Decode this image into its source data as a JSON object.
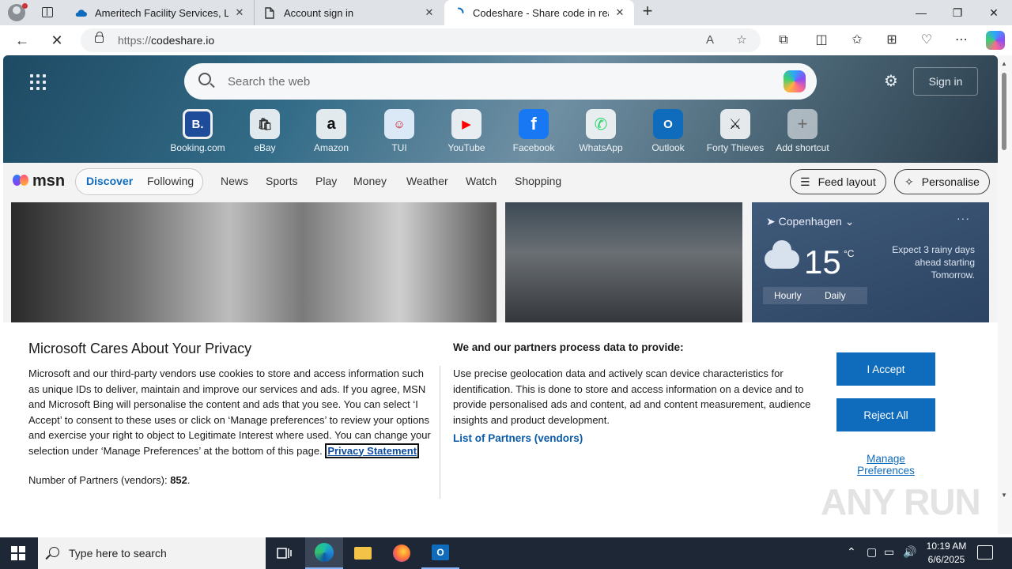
{
  "browser": {
    "tabs": [
      {
        "title": "Ameritech Facility Services, LLC -",
        "active": false
      },
      {
        "title": "Account sign in",
        "active": false
      },
      {
        "title": "Codeshare - Share code in real-ti",
        "active": true
      }
    ],
    "url_protocol": "https://",
    "url_host": "codeshare.io"
  },
  "msn": {
    "search_placeholder": "Search the web",
    "sign_in": "Sign in",
    "shortcuts": [
      {
        "label": "Booking.com",
        "glyph": "B."
      },
      {
        "label": "eBay",
        "glyph": "🛍"
      },
      {
        "label": "Amazon",
        "glyph": "a"
      },
      {
        "label": "TUI",
        "glyph": "☺"
      },
      {
        "label": "YouTube",
        "glyph": "▶"
      },
      {
        "label": "Facebook",
        "glyph": "f"
      },
      {
        "label": "WhatsApp",
        "glyph": "✆"
      },
      {
        "label": "Outlook",
        "glyph": "O"
      },
      {
        "label": "Forty Thieves",
        "glyph": "⚔"
      },
      {
        "label": "Add shortcut",
        "glyph": "+"
      }
    ],
    "logo": "msn",
    "pills": {
      "discover": "Discover",
      "following": "Following"
    },
    "nav": [
      "News",
      "Sports",
      "Play",
      "Money",
      "Weather",
      "Watch",
      "Shopping"
    ],
    "feed_layout": "Feed layout",
    "personalise": "Personalise",
    "weather": {
      "location": "Copenhagen",
      "temp": "15",
      "unit": "°C",
      "forecast": "Expect 3 rainy days ahead starting Tomorrow.",
      "tab_hourly": "Hourly",
      "tab_daily": "Daily"
    }
  },
  "consent": {
    "title": "Microsoft Cares About Your Privacy",
    "body": "Microsoft and our third-party vendors use cookies to store and access information such as unique IDs to deliver, maintain and improve our services and ads. If you agree, MSN and Microsoft Bing will personalise the content and ads that you see. You can select ‘I Accept’ to consent to these uses or click on ‘Manage preferences’ to review your options and exercise your right to object to Legitimate Interest where used.  You can change your selection under ‘Manage Preferences’ at the bottom of this page.",
    "privacy_link": "Privacy Statement",
    "partners_count_label": "Number of Partners (vendors):",
    "partners_count": "852",
    "purposes_heading": "We and our partners process data to provide:",
    "purposes_text": "Use precise geolocation data and actively scan device characteristics for identification. This is done to store and access information on a device and to provide personalised ads and content, ad and content measurement, audience insights and product development.",
    "partners_link": "List of Partners (vendors)",
    "accept": "I Accept",
    "reject": "Reject All",
    "manage": "Manage Preferences"
  },
  "watermark": "ANY RUN",
  "taskbar": {
    "search_placeholder": "Type here to search",
    "time": "10:19 AM",
    "date": "6/6/2025"
  }
}
